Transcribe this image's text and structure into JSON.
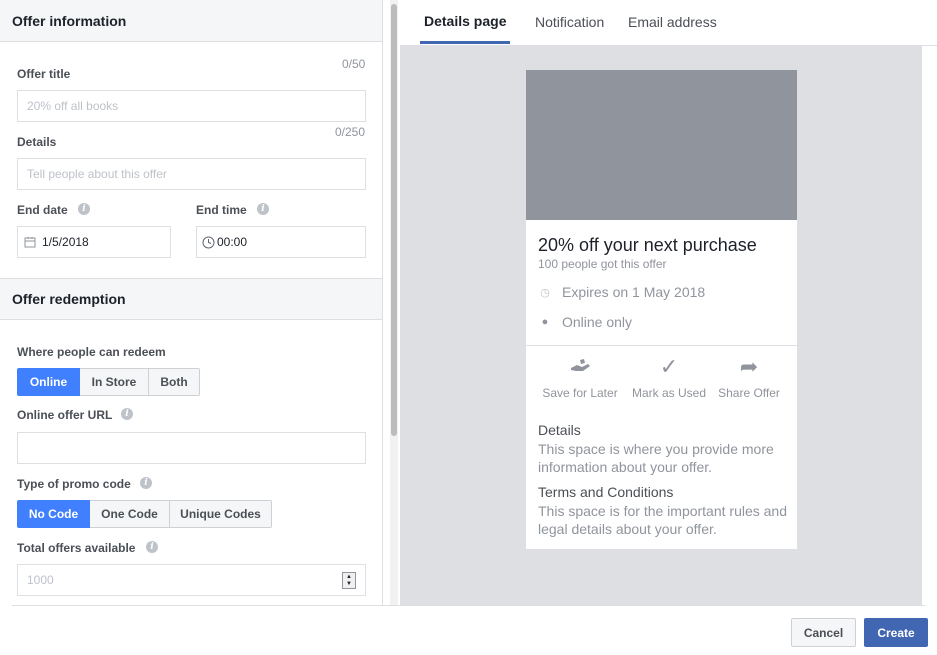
{
  "form": {
    "offer_info_heading": "Offer information",
    "offer_title": {
      "label": "Offer title",
      "counter": "0/50",
      "placeholder": "20% off all books"
    },
    "details": {
      "label": "Details",
      "counter": "0/250",
      "placeholder": "Tell people about this offer"
    },
    "end_date": {
      "label": "End date",
      "value": "1/5/2018"
    },
    "end_time": {
      "label": "End time",
      "value": "00:00"
    },
    "redemption_heading": "Offer redemption",
    "where_redeem": {
      "label": "Where people can redeem",
      "options": [
        "Online",
        "In Store",
        "Both"
      ],
      "selected": "Online"
    },
    "online_url": {
      "label": "Online offer URL",
      "value": ""
    },
    "promo_code": {
      "label": "Type of promo code",
      "options": [
        "No Code",
        "One Code",
        "Unique Codes"
      ],
      "selected": "No Code"
    },
    "total_offers": {
      "label": "Total offers available",
      "placeholder": "1000"
    }
  },
  "preview": {
    "tabs": [
      "Details page",
      "Notification",
      "Email address"
    ],
    "active_tab": "Details page",
    "card": {
      "title": "20% off your next purchase",
      "subtitle": "100 people got this offer",
      "expires": "Expires on 1 May 2018",
      "location": "Online only",
      "actions": [
        "Save for Later",
        "Mark as Used",
        "Share Offer"
      ],
      "details_heading": "Details",
      "details_text": "This space is where you provide more information about your offer.",
      "terms_heading": "Terms and Conditions",
      "terms_text": "This space is for the important rules and legal details about your offer."
    }
  },
  "footer": {
    "cancel": "Cancel",
    "create": "Create"
  },
  "icons": {
    "info": "info-icon",
    "calendar": "calendar-icon",
    "clock": "clock-icon",
    "globe": "globe-icon",
    "save": "hand-save-icon",
    "check": "checkmark-icon",
    "share": "share-arrow-icon"
  },
  "colors": {
    "primary": "#4267b2",
    "active_segment": "#4080ff",
    "placeholder_image": "#90949c"
  }
}
